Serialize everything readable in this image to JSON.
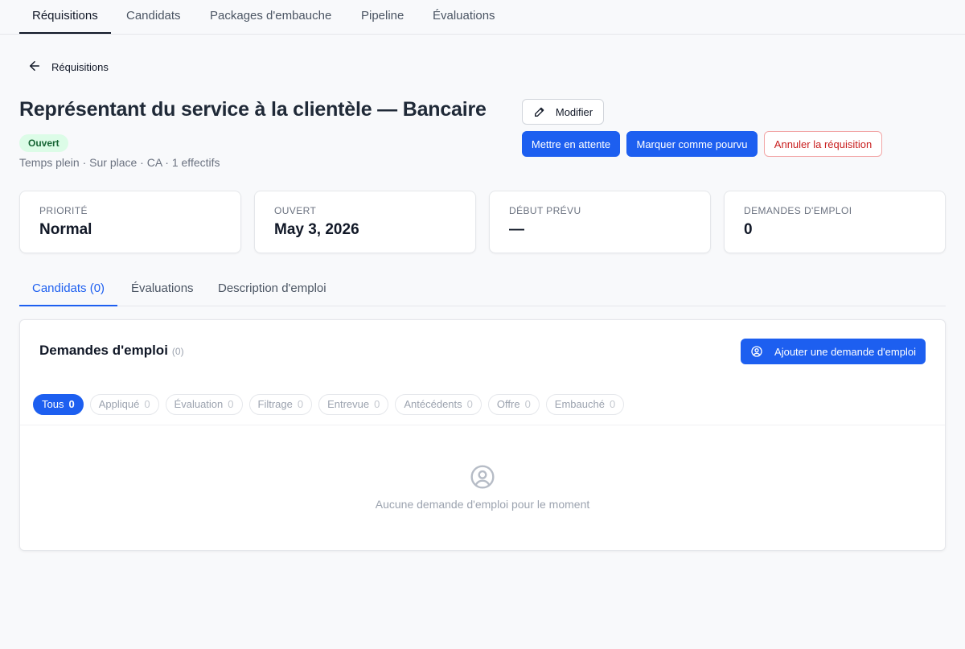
{
  "topnav": {
    "tabs": [
      {
        "label": "Réquisitions",
        "active": true
      },
      {
        "label": "Candidats"
      },
      {
        "label": "Packages d'embauche"
      },
      {
        "label": "Pipeline"
      },
      {
        "label": "Évaluations"
      }
    ]
  },
  "breadcrumb": {
    "back_label": "Réquisitions",
    "icon": "arrow-left-icon"
  },
  "header": {
    "title": "Représentant du service à la clientèle — Bancaire",
    "status": "Ouvert",
    "meta": "Temps plein · Sur place · CA · 1 effectifs"
  },
  "actions": {
    "edit_label": "Modifier",
    "hold_label": "Mettre en attente",
    "filled_label": "Marquer comme pourvu",
    "cancel_label": "Annuler la réquisition"
  },
  "stats": [
    {
      "label": "Priorité",
      "value": "Normal"
    },
    {
      "label": "Ouvert",
      "value": "May 3, 2026"
    },
    {
      "label": "Début prévu",
      "value": "—"
    },
    {
      "label": "Demandes d'emploi",
      "value": "0"
    }
  ],
  "subtabs": [
    {
      "label": "Candidats (0)",
      "active": true
    },
    {
      "label": "Évaluations"
    },
    {
      "label": "Description d'emploi"
    }
  ],
  "panel": {
    "title": "Demandes d'emploi",
    "count": "(0)",
    "add_button_label": "Ajouter une demande d'emploi",
    "filters": [
      {
        "label": "Tous",
        "count": "0",
        "active": true
      },
      {
        "label": "Appliqué",
        "count": "0"
      },
      {
        "label": "Évaluation",
        "count": "0"
      },
      {
        "label": "Filtrage",
        "count": "0"
      },
      {
        "label": "Entrevue",
        "count": "0"
      },
      {
        "label": "Antécédents",
        "count": "0"
      },
      {
        "label": "Offre",
        "count": "0"
      },
      {
        "label": "Embauché",
        "count": "0"
      }
    ],
    "empty_text": "Aucune demande d'emploi pour le moment"
  },
  "colors": {
    "accent": "#1d5ff0",
    "success_bg": "#dcfce7",
    "success_text": "#166534",
    "danger": "#c81e1e"
  }
}
